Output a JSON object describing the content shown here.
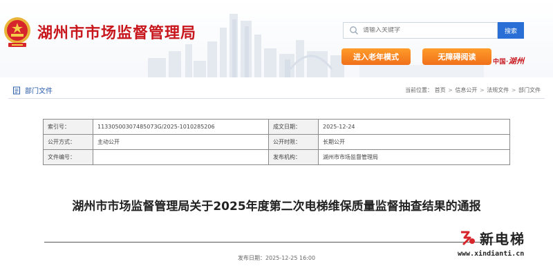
{
  "header": {
    "site_title": "湖州市市场监督管理局",
    "search_placeholder": "请输入关键字",
    "search_button": "搜索",
    "elder_mode_button": "进入老年模式",
    "accessible_read_button": "无障碍阅读",
    "china_huzhou_prefix": "中国·",
    "china_huzhou_city": "湖州"
  },
  "breadcrumb": {
    "section_title": "部门文件",
    "prefix": "当前位置：",
    "items": [
      "首页",
      "信息公开",
      "法规文件",
      "部门文件"
    ],
    "separator": ">"
  },
  "meta": {
    "rows": [
      {
        "k1": "索引号：",
        "v1": "11330500307485073G/2025-1010285206",
        "k2": "成文日期：",
        "v2": "2025-12-24"
      },
      {
        "k1": "公开方式：",
        "v1": "主动公开",
        "k2": "公开时限：",
        "v2": "长期公开"
      },
      {
        "k1": "文件编号：",
        "v1": "",
        "k2": "发布机构：",
        "v2": "湖州市市场监督管理局"
      }
    ]
  },
  "article": {
    "title": "湖州市市场监督管理局关于2025年度第二次电梯维保质量监督抽查结果的通报",
    "publish_date": "发布日期：2025-12-25 16:00"
  },
  "watermark": {
    "name": "新电梯",
    "url": "www.xindianti.cn"
  },
  "colors": {
    "brand_red": "#c8161d",
    "accent_blue": "#2a6fd6",
    "orange": "#f0701a"
  }
}
